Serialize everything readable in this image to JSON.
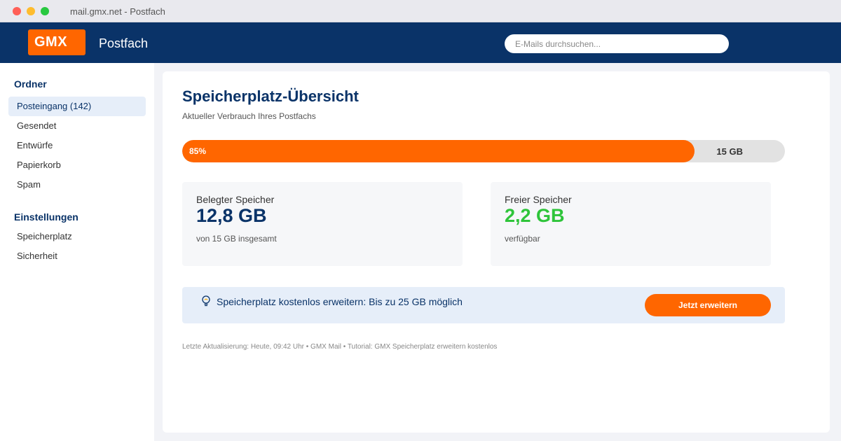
{
  "colors": {
    "brand_blue": "#0a3368",
    "accent_orange": "#ff6600",
    "free_green": "#2ec43a",
    "dot_red": "#ff5f57",
    "dot_yellow": "#febc2e",
    "dot_green": "#28c840"
  },
  "browser": {
    "url": "mail.gmx.net - Postfach"
  },
  "header": {
    "logo": "GMX",
    "title": "Postfach",
    "search_placeholder": "E-Mails durchsuchen..."
  },
  "sidebar": {
    "folders_heading": "Ordner",
    "folders": [
      {
        "label": "Posteingang (142)",
        "active": true
      },
      {
        "label": "Gesendet"
      },
      {
        "label": "Entwürfe"
      },
      {
        "label": "Papierkorb"
      },
      {
        "label": "Spam"
      }
    ],
    "settings_heading": "Einstellungen",
    "settings": [
      {
        "label": "Speicherplatz"
      },
      {
        "label": "Sicherheit"
      }
    ]
  },
  "main": {
    "title": "Speicherplatz-Übersicht",
    "subtitle": "Aktueller Verbrauch Ihres Postfachs",
    "usage": {
      "percent": 85,
      "percent_label": "85%",
      "total_label": "15 GB"
    },
    "used": {
      "label": "Belegter Speicher",
      "value": "12,8 GB",
      "note": "von 15 GB insgesamt"
    },
    "free": {
      "label": "Freier Speicher",
      "value": "2,2 GB",
      "note": "verfügbar"
    },
    "promo": {
      "icon": "lightbulb-icon",
      "text": "Speicherplatz kostenlos erweitern: Bis zu 25 GB möglich",
      "button": "Jetzt erweitern"
    },
    "footer": "Letzte Aktualisierung: Heute, 09:42 Uhr • GMX Mail • Tutorial: GMX Speicherplatz erweitern kostenlos"
  }
}
